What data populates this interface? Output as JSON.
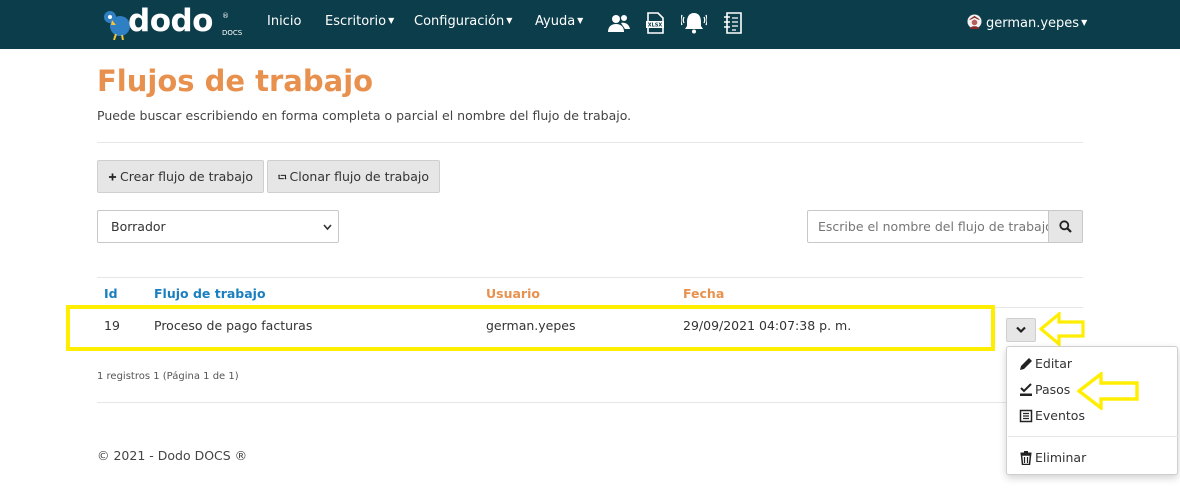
{
  "nav": {
    "logo_text": "dodo",
    "logo_sub": "DOCS",
    "logo_reg": "®",
    "items": [
      {
        "label": "Inicio",
        "dropdown": false
      },
      {
        "label": "Escritorio",
        "dropdown": true
      },
      {
        "label": "Configuración",
        "dropdown": true
      },
      {
        "label": "Ayuda",
        "dropdown": true
      }
    ],
    "icons": [
      "users-icon",
      "xlsx-file-icon",
      "bell-icon",
      "document-list-icon"
    ],
    "user": "german.yepes",
    "background": "#0b3d4b"
  },
  "page": {
    "title": "Flujos de trabajo",
    "subtitle": "Puede buscar escribiendo en forma completa o parcial el nombre del flujo de trabajo.",
    "accent_color": "#e8914e",
    "link_color": "#1a7fbf"
  },
  "toolbar": {
    "create_label": "Crear flujo de trabajo",
    "clone_label": "Clonar flujo de trabajo"
  },
  "filter": {
    "selected": "Borrador"
  },
  "search": {
    "placeholder": "Escribe el nombre del flujo de trabajo"
  },
  "table": {
    "columns": [
      "Id",
      "Flujo de trabajo",
      "Usuario",
      "Fecha"
    ],
    "rows": [
      {
        "id": "19",
        "workflow": "Proceso de pago facturas",
        "user": "german.yepes",
        "date": "29/09/2021 04:07:38 p. m."
      }
    ]
  },
  "pager": {
    "text": "1 registros 1 (Página 1 de 1)"
  },
  "row_menu": {
    "items": [
      {
        "label": "Editar",
        "icon": "pencil-icon"
      },
      {
        "label": "Pasos",
        "icon": "checklist-icon"
      },
      {
        "label": "Eventos",
        "icon": "list-icon"
      },
      {
        "label": "Eliminar",
        "icon": "trash-icon"
      }
    ]
  },
  "annotations": {
    "highlight_color": "#ffee00"
  },
  "footer": {
    "text": "© 2021 - Dodo DOCS ®"
  }
}
